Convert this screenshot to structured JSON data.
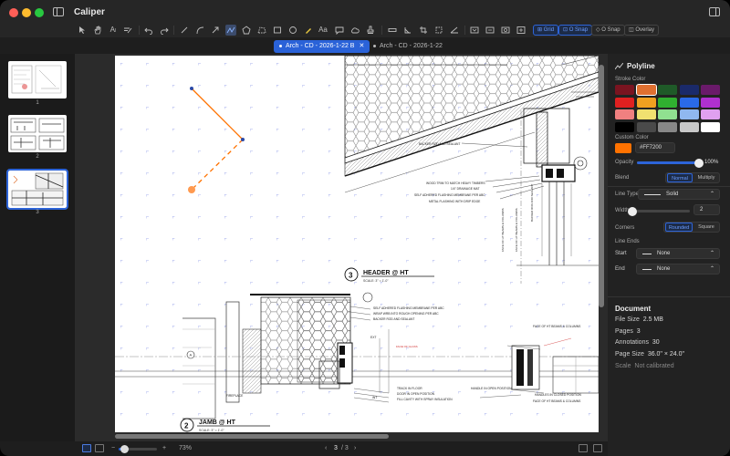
{
  "app": {
    "title": "Caliper"
  },
  "toolbar": {
    "icons": [
      "cursor-icon",
      "hand-icon",
      "text-icon",
      "markup-icon",
      "undo-icon",
      "redo-icon",
      "line-icon",
      "arc-icon",
      "arrow-icon",
      "polyline-icon",
      "polygon-icon",
      "area-icon",
      "rectangle-icon",
      "ellipse-icon",
      "highlighter-icon",
      "text-box-icon",
      "callout-icon",
      "cloud-icon",
      "stamp-icon",
      "dimension-icon",
      "angle-icon",
      "crop-icon",
      "measure-icon",
      "scale-icon",
      "slope-icon",
      "fit-page-icon",
      "fit-width-icon",
      "zoom-area-icon",
      "zoom-icon"
    ],
    "grid_label": "Grid",
    "osnap_label": "O Snap",
    "osnap2_label": "O Snap",
    "overlay_label": "Overlay"
  },
  "tabs": [
    {
      "label": "Arch - CD - 2026-1-22 B",
      "active": true
    },
    {
      "label": "Arch - CD - 2026-1-22",
      "active": false
    }
  ],
  "thumbnails": [
    {
      "number": "1"
    },
    {
      "number": "2"
    },
    {
      "number": "3",
      "selected": true
    }
  ],
  "drawing": {
    "detail_3_number": "3",
    "detail_3_title": "HEADER @ HT",
    "detail_3_scale": "SCALE: 3\" = 1'-0\"",
    "detail_2_number": "2",
    "detail_2_title": "JAMB @ HT",
    "detail_2_scale": "SCALE: 3\" = 1'-0\"",
    "notes_top": [
      "BACKER ROD AND SEALANT",
      "WOOD TRIM TO MATCH HEAVY TIMBERS",
      "1/4\" DRAINAGE MAT",
      "SELF ADHERED FLASHING MEMBRANE PER ABC",
      "METAL FLASHING WITH DRIP EDGE"
    ],
    "notes_bottom": [
      "SELF ADHERED FLASHING MEMBRANE PER ABC",
      "WRAP WRB INTO ROUGH OPENING PER ABC",
      "BACKER ROD AND SEALANT",
      "TRACK IN FLOOR",
      "DOOR IN OPEN POSITION",
      "FILL CAVITY WITH SPRAY INSULATION",
      "HANDLE IN OPEN POSITION",
      "HANDLES IN CLOSED POSITION",
      "FACE OF HT BEAMS & COLUMNS",
      "FACE OF HT BEAMS & COLUMNS",
      "FIREPLACE",
      "EXT",
      "INT"
    ],
    "vertical_notes": [
      "BACKER ROD AND SEALANT",
      "FACE OF HT BEAMS & COLUMNS"
    ],
    "grid_bubble": "A",
    "face_of_glass": "FACE OF GLASS"
  },
  "bottombar": {
    "zoom": "73%",
    "page": "3",
    "page_total": "/ 3",
    "prev": "‹",
    "next": "›",
    "zoom_minus": "−",
    "zoom_plus": "+",
    "zoom_level": 0.15
  },
  "inspector": {
    "title": "Polyline",
    "stroke_color_label": "Stroke Color",
    "palette": [
      [
        "#7a1420",
        "#e07030",
        "#1f5a28",
        "#1a2a6a",
        "#6a1a6a"
      ],
      [
        "#e02020",
        "#f0a020",
        "#30b030",
        "#2a6ae8",
        "#b030d0"
      ],
      [
        "#f08080",
        "#f0e070",
        "#90e090",
        "#90b8f0",
        "#e0a0f0"
      ],
      [
        "#000000",
        "#4a4a4a",
        "#888888",
        "#c8c8c8",
        "#ffffff"
      ]
    ],
    "selected_swatch": "#e07030",
    "custom_color_label": "Custom Color",
    "custom_color_value": "#FF7200",
    "opacity_label": "Opacity",
    "opacity_value": "100%",
    "opacity_level": 1,
    "blend_label": "Blend",
    "blend_options": [
      "Normal",
      "Multiply"
    ],
    "blend_selected": "Normal",
    "line_type_label": "Line Type",
    "line_type_value": "Solid",
    "width_label": "Width",
    "width_value": "2",
    "width_level": 0.05,
    "corners_label": "Corners",
    "corner_options": [
      "Rounded",
      "Square"
    ],
    "corner_selected": "Rounded",
    "line_ends_label": "Line Ends",
    "start_label": "Start",
    "start_value": "None",
    "end_label": "End",
    "end_value": "None",
    "document_title": "Document",
    "file_size_label": "File Size",
    "file_size_value": "2.5 MB",
    "pages_label": "Pages",
    "pages_value": "3",
    "annotations_label": "Annotations",
    "annotations_value": "30",
    "page_size_label": "Page Size",
    "page_size_value": "36.0\" × 24.0\"",
    "scale_label": "Scale",
    "scale_value": "Not calibrated"
  },
  "colors": {
    "accent": "#2a62d8",
    "annotation": "#ff7200",
    "window": "#1e1e1e"
  }
}
